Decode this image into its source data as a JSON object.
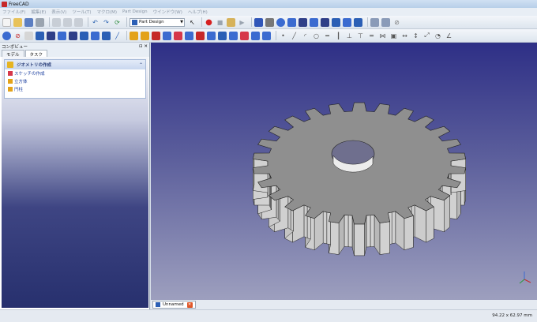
{
  "window": {
    "title": "FreeCAD"
  },
  "menubar": {
    "items": [
      "ファイル(F)",
      "編集(E)",
      "表示(V)",
      "ツール(T)",
      "マクロ(M)",
      "Part Design",
      "ウインドウ(W)",
      "ヘルプ(H)"
    ]
  },
  "toolbar": {
    "workbench": "Part Design"
  },
  "combo_view": {
    "title": "コンボビュー",
    "buttons": "⊡ ✕",
    "tabs": [
      {
        "label": "モデル"
      },
      {
        "label": "タスク"
      }
    ],
    "task_panel": {
      "title": "ジオメトリの作成",
      "items": [
        {
          "label": "スケッチの作成",
          "icon": "sketch-icon"
        },
        {
          "label": "立方体",
          "icon": "cube-icon"
        },
        {
          "label": "円柱",
          "icon": "cylinder-icon"
        }
      ]
    }
  },
  "document_tab": {
    "label": "Unnamed",
    "close": "✕"
  },
  "status": {
    "dimensions": "94.22 x 62.97 mm"
  },
  "colors": {
    "viewport_top": "#2e2f86",
    "viewport_bottom": "#9d9fbe",
    "gear_face": "#8f8f8f"
  }
}
